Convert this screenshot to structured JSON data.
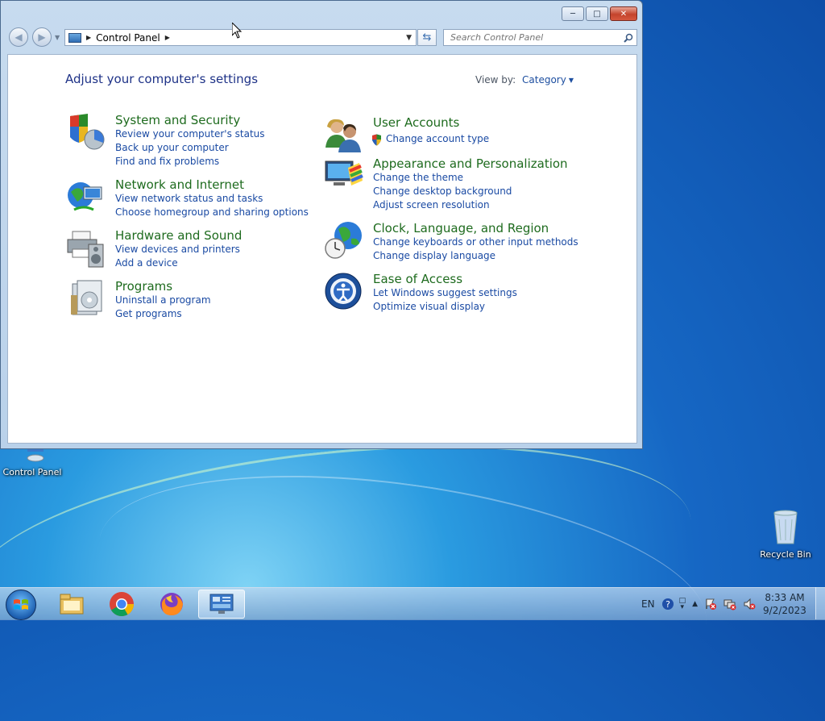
{
  "window": {
    "address": {
      "crumb": "Control Panel"
    },
    "search": {
      "placeholder": "Search Control Panel"
    },
    "heading": "Adjust your computer's settings",
    "view_by_label": "View by:",
    "view_by_value": "Category",
    "left_categories": [
      {
        "title": "System and Security",
        "links": [
          "Review your computer's status",
          "Back up your computer",
          "Find and fix problems"
        ]
      },
      {
        "title": "Network and Internet",
        "links": [
          "View network status and tasks",
          "Choose homegroup and sharing options"
        ]
      },
      {
        "title": "Hardware and Sound",
        "links": [
          "View devices and printers",
          "Add a device"
        ]
      },
      {
        "title": "Programs",
        "links": [
          "Uninstall a program",
          "Get programs"
        ]
      }
    ],
    "right_categories": [
      {
        "title": "User Accounts",
        "links": [
          "Change account type"
        ]
      },
      {
        "title": "Appearance and Personalization",
        "links": [
          "Change the theme",
          "Change desktop background",
          "Adjust screen resolution"
        ]
      },
      {
        "title": "Clock, Language, and Region",
        "links": [
          "Change keyboards or other input methods",
          "Change display language"
        ]
      },
      {
        "title": "Ease of Access",
        "links": [
          "Let Windows suggest settings",
          "Optimize visual display"
        ]
      }
    ]
  },
  "desktop": {
    "icons": [
      {
        "label": "Control Panel",
        "icon": "control-panel-icon"
      },
      {
        "label": "Recycle Bin",
        "icon": "recycle-bin-icon"
      }
    ]
  },
  "taskbar": {
    "apps": [
      "file-explorer-icon",
      "chrome-icon",
      "firefox-icon",
      "control-panel-icon"
    ],
    "tray": {
      "language": "EN"
    },
    "clock": {
      "time": "8:33 AM",
      "date": "9/2/2023"
    }
  }
}
